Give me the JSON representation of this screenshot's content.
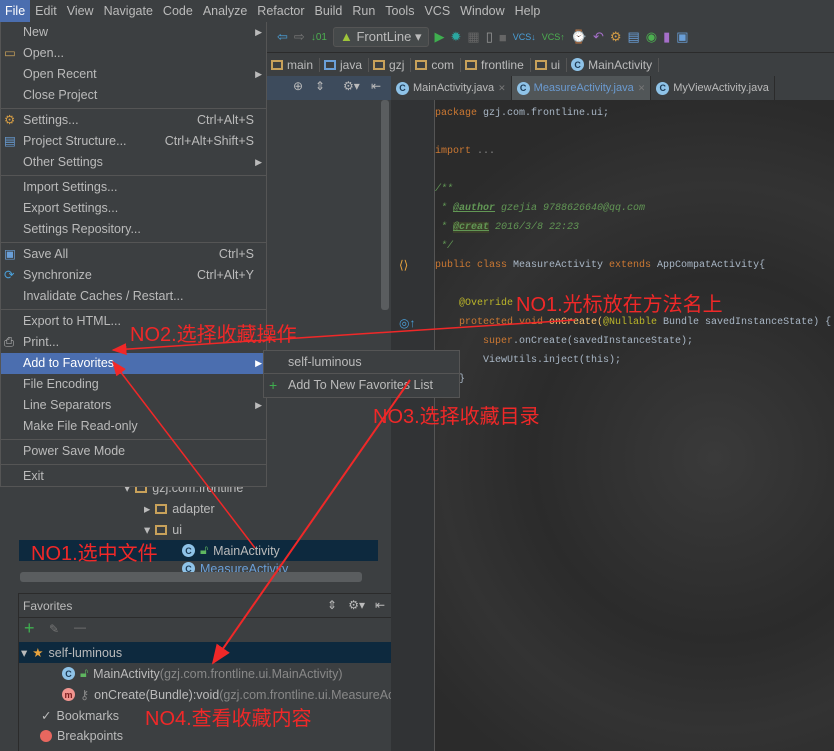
{
  "menubar": [
    "File",
    "Edit",
    "View",
    "Navigate",
    "Code",
    "Analyze",
    "Refactor",
    "Build",
    "Run",
    "Tools",
    "VCS",
    "Window",
    "Help"
  ],
  "toolbar": {
    "run_config": "FrontLine"
  },
  "breadcrumb": [
    "main",
    "java",
    "gzj",
    "com",
    "frontline",
    "ui",
    "MainActivity"
  ],
  "tabs": [
    {
      "label": "MainActivity.java",
      "active": false
    },
    {
      "label": "MeasureActivity.java",
      "active": true
    },
    {
      "label": "MyViewActivity.java",
      "active": false
    }
  ],
  "file_menu": [
    {
      "label": "New",
      "submenu": true
    },
    {
      "label": "Open...",
      "icon": "folder-icon"
    },
    {
      "label": "Open Recent",
      "submenu": true
    },
    {
      "label": "Close Project"
    },
    {
      "sep": true
    },
    {
      "label": "Settings...",
      "shortcut": "Ctrl+Alt+S",
      "icon": "settings-icon"
    },
    {
      "label": "Project Structure...",
      "shortcut": "Ctrl+Alt+Shift+S",
      "icon": "structure-icon"
    },
    {
      "label": "Other Settings",
      "submenu": true
    },
    {
      "sep": true
    },
    {
      "label": "Import Settings..."
    },
    {
      "label": "Export Settings..."
    },
    {
      "label": "Settings Repository..."
    },
    {
      "sep": true
    },
    {
      "label": "Save All",
      "shortcut": "Ctrl+S",
      "icon": "save-icon"
    },
    {
      "label": "Synchronize",
      "shortcut": "Ctrl+Alt+Y",
      "icon": "sync-icon"
    },
    {
      "label": "Invalidate Caches / Restart..."
    },
    {
      "sep": true
    },
    {
      "label": "Export to HTML..."
    },
    {
      "label": "Print...",
      "icon": "print-icon"
    },
    {
      "label": "Add to Favorites",
      "submenu": true,
      "highlighted": true
    },
    {
      "label": "File Encoding"
    },
    {
      "label": "Line Separators",
      "submenu": true
    },
    {
      "label": "Make File Read-only"
    },
    {
      "sep": true
    },
    {
      "label": "Power Save Mode"
    },
    {
      "sep": true
    },
    {
      "label": "Exit"
    }
  ],
  "submenu": {
    "items": [
      "self-luminous",
      "Add To New Favorites List"
    ]
  },
  "code": {
    "package": "package",
    "package_name": " gzj.com.frontline.ui;",
    "import": "import",
    "import_fold": " ...",
    "doc_open": "/**",
    "author_tag": "@author",
    "author_val": " gzejia 9788626640@qq.com",
    "creat_tag": "@creat",
    "creat_val": " 2016/3/8 22:23",
    "doc_close": " */",
    "class_line": [
      "public class ",
      "MeasureActivity ",
      "extends ",
      "AppCompatActivity{"
    ],
    "override": "@Override",
    "method_line": [
      "protected void ",
      "onCreate(",
      "@Nullable",
      " Bundle savedInstanceState) {"
    ],
    "super_line": [
      "super",
      ".onCreate(savedInstanceState);"
    ],
    "inject_line": "ViewUtils.inject(this);",
    "close": "}"
  },
  "tree": [
    {
      "label": "gzj.com.frontline"
    },
    {
      "label": "adapter"
    },
    {
      "label": "ui"
    },
    {
      "label": "MainActivity",
      "selected": true
    },
    {
      "label": "MeasureActivity"
    }
  ],
  "favorites": {
    "title": "Favorites",
    "list": "self-luminous",
    "items": [
      {
        "name": "MainActivity",
        "detail": " (gzj.com.frontline.ui.MainActivity)"
      },
      {
        "name": "onCreate(Bundle):void",
        "detail": " (gzj.com.frontline.ui.MeasureActivity)"
      }
    ],
    "bookmarks": "Bookmarks",
    "breakpoints": "Breakpoints"
  },
  "annotations": {
    "no1_cursor": "NO1.光标放在方法名上",
    "no2": "NO2.选择收藏操作",
    "no3": "NO3.选择收藏目录",
    "no1_file": "NO1.选中文件",
    "no4": "NO4.查看收藏内容"
  },
  "colors": {
    "accent": "#4b6eaf",
    "annotation": "#f02828",
    "selection": "#0d293e"
  }
}
